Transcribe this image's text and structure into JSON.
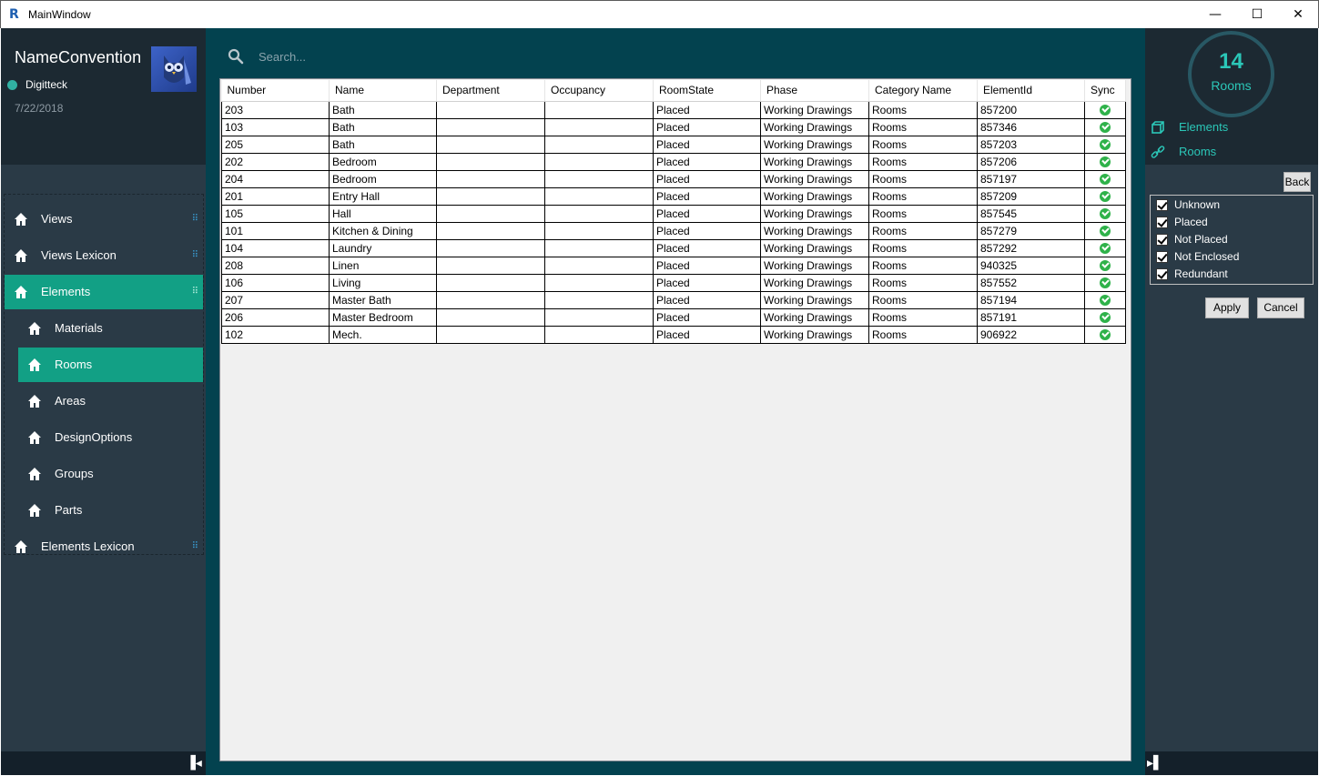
{
  "window": {
    "title": "MainWindow",
    "min_glyph": "—",
    "max_glyph": "☐",
    "close_glyph": "✕"
  },
  "profile": {
    "app_name": "NameConvention",
    "user": "Digitteck",
    "date": "7/22/2018"
  },
  "nav": {
    "items": [
      {
        "label": "Views"
      },
      {
        "label": "Views Lexicon"
      },
      {
        "label": "Elements"
      },
      {
        "label": "Materials"
      },
      {
        "label": "Rooms"
      },
      {
        "label": "Areas"
      },
      {
        "label": "DesignOptions"
      },
      {
        "label": "Groups"
      },
      {
        "label": "Parts"
      },
      {
        "label": "Elements Lexicon"
      }
    ],
    "dots_glyph": "⠿"
  },
  "search": {
    "placeholder": "Search..."
  },
  "grid": {
    "columns": [
      "Number",
      "Name",
      "Department",
      "Occupancy",
      "RoomState",
      "Phase",
      "Category Name",
      "ElementId",
      "Sync"
    ],
    "rows": [
      [
        "203",
        "Bath",
        "",
        "",
        "Placed",
        "Working Drawings",
        "Rooms",
        "857200"
      ],
      [
        "103",
        "Bath",
        "",
        "",
        "Placed",
        "Working Drawings",
        "Rooms",
        "857346"
      ],
      [
        "205",
        "Bath",
        "",
        "",
        "Placed",
        "Working Drawings",
        "Rooms",
        "857203"
      ],
      [
        "202",
        "Bedroom",
        "",
        "",
        "Placed",
        "Working Drawings",
        "Rooms",
        "857206"
      ],
      [
        "204",
        "Bedroom",
        "",
        "",
        "Placed",
        "Working Drawings",
        "Rooms",
        "857197"
      ],
      [
        "201",
        "Entry Hall",
        "",
        "",
        "Placed",
        "Working Drawings",
        "Rooms",
        "857209"
      ],
      [
        "105",
        "Hall",
        "",
        "",
        "Placed",
        "Working Drawings",
        "Rooms",
        "857545"
      ],
      [
        "101",
        "Kitchen & Dining",
        "",
        "",
        "Placed",
        "Working Drawings",
        "Rooms",
        "857279"
      ],
      [
        "104",
        "Laundry",
        "",
        "",
        "Placed",
        "Working Drawings",
        "Rooms",
        "857292"
      ],
      [
        "208",
        "Linen",
        "",
        "",
        "Placed",
        "Working Drawings",
        "Rooms",
        "940325"
      ],
      [
        "106",
        "Living",
        "",
        "",
        "Placed",
        "Working Drawings",
        "Rooms",
        "857552"
      ],
      [
        "207",
        "Master Bath",
        "",
        "",
        "Placed",
        "Working Drawings",
        "Rooms",
        "857194"
      ],
      [
        "206",
        "Master Bedroom",
        "",
        "",
        "Placed",
        "Working Drawings",
        "Rooms",
        "857191"
      ],
      [
        "102",
        "Mech.",
        "",
        "",
        "Placed",
        "Working Drawings",
        "Rooms",
        "906922"
      ]
    ],
    "sync_icon": "check-circle-icon"
  },
  "summary": {
    "count": "14",
    "unit": "Rooms"
  },
  "right_links": {
    "elements": "Elements",
    "rooms": "Rooms"
  },
  "filter": {
    "back": "Back",
    "options": [
      {
        "label": "Unknown",
        "checked": true
      },
      {
        "label": "Placed",
        "checked": true
      },
      {
        "label": "Not Placed",
        "checked": true
      },
      {
        "label": "Not Enclosed",
        "checked": true
      },
      {
        "label": "Redundant",
        "checked": true
      }
    ],
    "apply": "Apply",
    "cancel": "Cancel"
  },
  "colors": {
    "accent": "#12a085",
    "teal_text": "#2bc7b8",
    "main_bg": "#03424f",
    "sidebar_bg": "#2a3a46"
  }
}
